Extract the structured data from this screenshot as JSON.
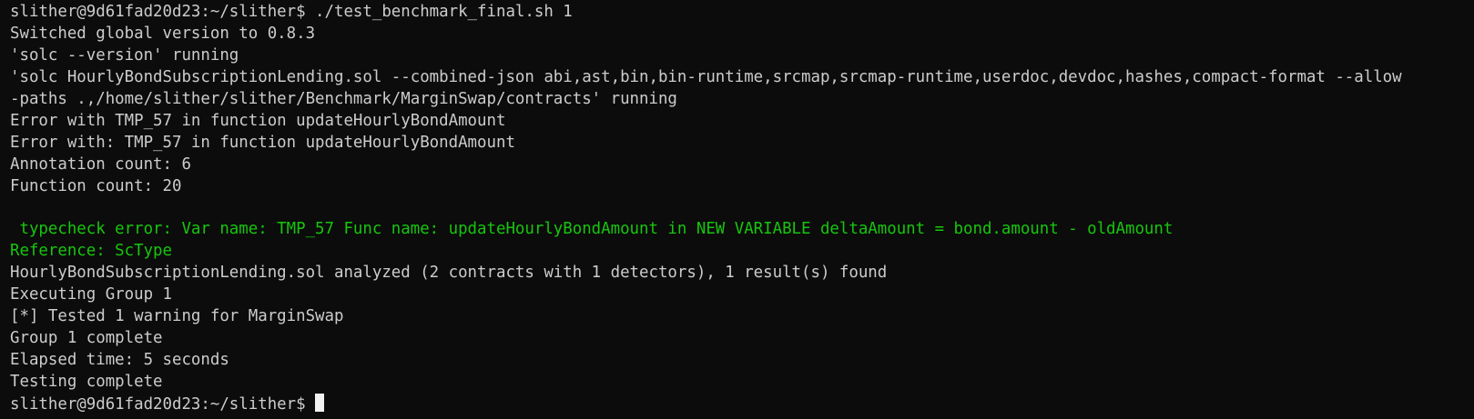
{
  "terminal": {
    "lines": [
      "slither@9d61fad20d23:~/slither$ ./test_benchmark_final.sh 1",
      "Switched global version to 0.8.3",
      "'solc --version' running",
      "'solc HourlyBondSubscriptionLending.sol --combined-json abi,ast,bin,bin-runtime,srcmap,srcmap-runtime,userdoc,devdoc,hashes,compact-format --allow",
      "-paths .,/home/slither/slither/Benchmark/MarginSwap/contracts' running",
      "Error with TMP_57 in function updateHourlyBondAmount",
      "Error with: TMP_57 in function updateHourlyBondAmount",
      "Annotation count: 6",
      "Function count: 20",
      "",
      " typecheck error: Var name: TMP_57 Func name: updateHourlyBondAmount in NEW VARIABLE deltaAmount = bond.amount - oldAmount",
      "Reference: ScType",
      "HourlyBondSubscriptionLending.sol analyzed (2 contracts with 1 detectors), 1 result(s) found",
      "Executing Group 1",
      "[*] Tested 1 warning for MarginSwap",
      "Group 1 complete",
      "Elapsed time: 5 seconds",
      "Testing complete",
      "slither@9d61fad20d23:~/slither$ "
    ]
  },
  "colors": {
    "background": "#0c0c0c",
    "text": "#cccccc",
    "highlight": "#16c60c",
    "cursor": "#f2f2f2"
  }
}
